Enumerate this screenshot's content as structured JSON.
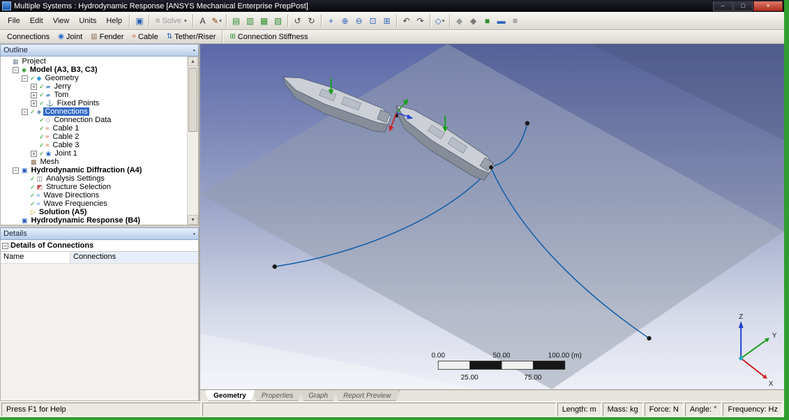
{
  "titlebar": {
    "title": "Multiple Systems : Hydrodynamic Response [ANSYS Mechanical Enterprise PrepPost]"
  },
  "window_buttons": {
    "minimize": "–",
    "maximize": "□",
    "close": "×"
  },
  "menubar": {
    "menus": [
      "File",
      "Edit",
      "View",
      "Units",
      "Help"
    ]
  },
  "toolbar_main": {
    "items": [
      {
        "type": "icon",
        "name": "save-icon",
        "glyph": "▣",
        "color": "#2a62b8"
      },
      {
        "type": "sep"
      },
      {
        "type": "button",
        "name": "solve-button",
        "icon_name": "solve-icon",
        "glyph": "≡",
        "color": "#8a8a8a",
        "label": "Solve",
        "disabled": true,
        "dropdown": true
      },
      {
        "type": "sep"
      },
      {
        "type": "icon",
        "name": "worksheet-icon",
        "glyph": "A",
        "color": "#333333"
      },
      {
        "type": "icon",
        "name": "annotation-pen-icon",
        "glyph": "✎",
        "color": "#8b4513",
        "dropdown": true
      },
      {
        "type": "sep"
      },
      {
        "type": "icon",
        "name": "copy-icon",
        "glyph": "▤",
        "color": "#2f8f2f"
      },
      {
        "type": "icon",
        "name": "chart-icon",
        "glyph": "▥",
        "color": "#2f8f2f"
      },
      {
        "type": "icon",
        "name": "image-icon",
        "glyph": "▦",
        "color": "#2f8f2f"
      },
      {
        "type": "icon",
        "name": "report-icon",
        "glyph": "▧",
        "color": "#2f8f2f"
      },
      {
        "type": "sep"
      },
      {
        "type": "icon",
        "name": "undo-view-icon",
        "glyph": "↺",
        "color": "#444444"
      },
      {
        "type": "icon",
        "name": "redo-view-icon",
        "glyph": "↻",
        "color": "#444444"
      },
      {
        "type": "sep"
      },
      {
        "type": "icon",
        "name": "pan-icon",
        "glyph": "+",
        "color": "#2a62b8"
      },
      {
        "type": "icon",
        "name": "zoom-in-icon",
        "glyph": "⊕",
        "color": "#2a62b8"
      },
      {
        "type": "icon",
        "name": "zoom-out-icon",
        "glyph": "⊖",
        "color": "#2a62b8"
      },
      {
        "type": "icon",
        "name": "box-zoom-icon",
        "glyph": "⊡",
        "color": "#2a62b8"
      },
      {
        "type": "icon",
        "name": "zoom-fit-icon",
        "glyph": "⊞",
        "color": "#2a62b8"
      },
      {
        "type": "sep"
      },
      {
        "type": "icon",
        "name": "prev-view-icon",
        "glyph": "↶",
        "color": "#444444"
      },
      {
        "type": "icon",
        "name": "next-view-icon",
        "glyph": "↷",
        "color": "#444444"
      },
      {
        "type": "sep"
      },
      {
        "type": "icon",
        "name": "iso-view-icon",
        "glyph": "◇",
        "color": "#2a62b8",
        "dropdown": true
      },
      {
        "type": "sep"
      },
      {
        "type": "icon",
        "name": "wireframe-mode-icon",
        "glyph": "◆",
        "color": "#999999"
      },
      {
        "type": "icon",
        "name": "shaded-mode-icon",
        "glyph": "◆",
        "color": "#777777"
      },
      {
        "type": "icon",
        "name": "show-mesh-icon",
        "glyph": "■",
        "color": "#2f8f2f"
      },
      {
        "type": "icon",
        "name": "viewports-icon",
        "glyph": "▬",
        "color": "#2a62b8"
      },
      {
        "type": "icon",
        "name": "legend-icon",
        "glyph": "≡",
        "color": "#555555"
      }
    ]
  },
  "toolbar_connections": {
    "buttons": [
      {
        "label": "Connections",
        "name": "connections-button",
        "glyph": "",
        "color": ""
      },
      {
        "label": "Joint",
        "name": "joint-button",
        "glyph": "◉",
        "color": "#2266cc"
      },
      {
        "label": "Fender",
        "name": "fender-button",
        "glyph": "▥",
        "color": "#8a6a4a"
      },
      {
        "label": "Cable",
        "name": "cable-button",
        "glyph": "≈",
        "color": "#cc4422"
      },
      {
        "label": "Tether/Riser",
        "name": "tether-riser-button",
        "glyph": "⇅",
        "color": "#2266cc"
      },
      {
        "sep_before": true,
        "label": "Connection Stiffness",
        "name": "connection-stiffness-button",
        "glyph": "⊞",
        "color": "#2f8f2f"
      }
    ]
  },
  "outline": {
    "header": "Outline",
    "tree": [
      {
        "label": "Project",
        "level": 0,
        "expander": "",
        "check": false,
        "icon": "project-icon",
        "glyph": "▦",
        "color": "#7a8aa0",
        "bold": false,
        "selected": false
      },
      {
        "label": "Model (A3, B3, C3)",
        "level": 1,
        "expander": "-",
        "check": false,
        "icon": "model-icon",
        "glyph": "◆",
        "color": "#44aa44",
        "bold": true,
        "selected": false
      },
      {
        "label": "Geometry",
        "level": 2,
        "expander": "-",
        "check": true,
        "icon": "geometry-icon",
        "glyph": "◆",
        "color": "#2f9bd6",
        "bold": false,
        "selected": false
      },
      {
        "label": "Jerry",
        "level": 3,
        "expander": "+",
        "check": true,
        "icon": "part-icon",
        "glyph": "▰",
        "color": "#6a9fd8",
        "bold": false,
        "selected": false
      },
      {
        "label": "Tom",
        "level": 3,
        "expander": "+",
        "check": true,
        "icon": "part-icon",
        "glyph": "▰",
        "color": "#6a9fd8",
        "bold": false,
        "selected": false
      },
      {
        "label": "Fixed Points",
        "level": 3,
        "expander": "+",
        "check": true,
        "icon": "fixed-points-icon",
        "glyph": "⚓",
        "color": "#3a4a5a",
        "bold": false,
        "selected": false
      },
      {
        "label": "Connections",
        "level": 2,
        "expander": "-",
        "check": true,
        "icon": "connections-icon",
        "glyph": "◈",
        "color": "#5577aa",
        "bold": false,
        "selected": true
      },
      {
        "label": "Connection Data",
        "level": 3,
        "expander": "",
        "check": true,
        "icon": "connection-data-icon",
        "glyph": "◇",
        "color": "#888888",
        "bold": false,
        "selected": false
      },
      {
        "label": "Cable 1",
        "level": 3,
        "expander": "",
        "check": true,
        "icon": "cable-icon",
        "glyph": "≈",
        "color": "#cc4422",
        "bold": false,
        "selected": false
      },
      {
        "label": "Cable 2",
        "level": 3,
        "expander": "",
        "check": true,
        "icon": "cable-icon",
        "glyph": "≈",
        "color": "#cc4422",
        "bold": false,
        "selected": false
      },
      {
        "label": "Cable 3",
        "level": 3,
        "expander": "",
        "check": true,
        "icon": "cable-icon",
        "glyph": "≈",
        "color": "#cc4422",
        "bold": false,
        "selected": false
      },
      {
        "label": "Joint 1",
        "level": 3,
        "expander": "+",
        "check": true,
        "icon": "joint-icon",
        "glyph": "◉",
        "color": "#2266cc",
        "bold": false,
        "selected": false
      },
      {
        "label": "Mesh",
        "level": 2,
        "expander": "",
        "check": false,
        "icon": "mesh-icon",
        "glyph": "▩",
        "color": "#8a6a4a",
        "bold": false,
        "selected": false
      },
      {
        "label": "Hydrodynamic Diffraction (A4)",
        "level": 1,
        "expander": "-",
        "check": false,
        "icon": "analysis-system-icon",
        "glyph": "▣",
        "color": "#2255bb",
        "bold": true,
        "selected": false
      },
      {
        "label": "Analysis Settings",
        "level": 2,
        "expander": "",
        "check": true,
        "icon": "analysis-settings-icon",
        "glyph": "◫",
        "color": "#666666",
        "bold": false,
        "selected": false
      },
      {
        "label": "Structure Selection",
        "level": 2,
        "expander": "",
        "check": true,
        "icon": "structure-selection-icon",
        "glyph": "◩",
        "color": "#cc4444",
        "bold": false,
        "selected": false
      },
      {
        "label": "Wave Directions",
        "level": 2,
        "expander": "",
        "check": true,
        "icon": "wave-directions-icon",
        "glyph": "≈",
        "color": "#2288cc",
        "bold": false,
        "selected": false
      },
      {
        "label": "Wave Frequencies",
        "level": 2,
        "expander": "",
        "check": true,
        "icon": "wave-frequencies-icon",
        "glyph": "≈",
        "color": "#2288cc",
        "bold": false,
        "selected": false
      },
      {
        "label": "Solution (A5)",
        "level": 2,
        "expander": "",
        "check": false,
        "icon": "solution-icon",
        "glyph": "▷",
        "color": "#d4a017",
        "bold": true,
        "selected": false
      },
      {
        "label": "Hydrodynamic Response (B4)",
        "level": 1,
        "expander": "",
        "check": false,
        "icon": "analysis-system-icon",
        "glyph": "▣",
        "color": "#2255bb",
        "bold": true,
        "selected": false
      }
    ]
  },
  "details": {
    "header": "Details",
    "group_title": "Details of Connections",
    "rows": [
      {
        "name": "Name",
        "value": "Connections"
      }
    ]
  },
  "viewport": {
    "scale_bar": {
      "top_labels": [
        "0.00",
        "50.00",
        "100.00 (m)"
      ],
      "bottom_labels": [
        "25.00",
        "75.00"
      ]
    },
    "triad": {
      "x": "X",
      "y": "Y",
      "z": "Z"
    }
  },
  "tabs": [
    {
      "label": "Geometry",
      "active": true
    },
    {
      "label": "Properties",
      "active": false
    },
    {
      "label": "Graph",
      "active": false
    },
    {
      "label": "Report Preview",
      "active": false
    }
  ],
  "statusbar": {
    "left": "Press F1 for Help",
    "units": [
      "Length: m",
      "Mass: kg",
      "Force: N",
      "Angle: °",
      "Frequency: Hz"
    ]
  },
  "colors": {
    "selection": "#3169c6",
    "check_green": "#189818",
    "cable_blue": "#1560a8",
    "desktop_green": "#2f9e2f"
  }
}
